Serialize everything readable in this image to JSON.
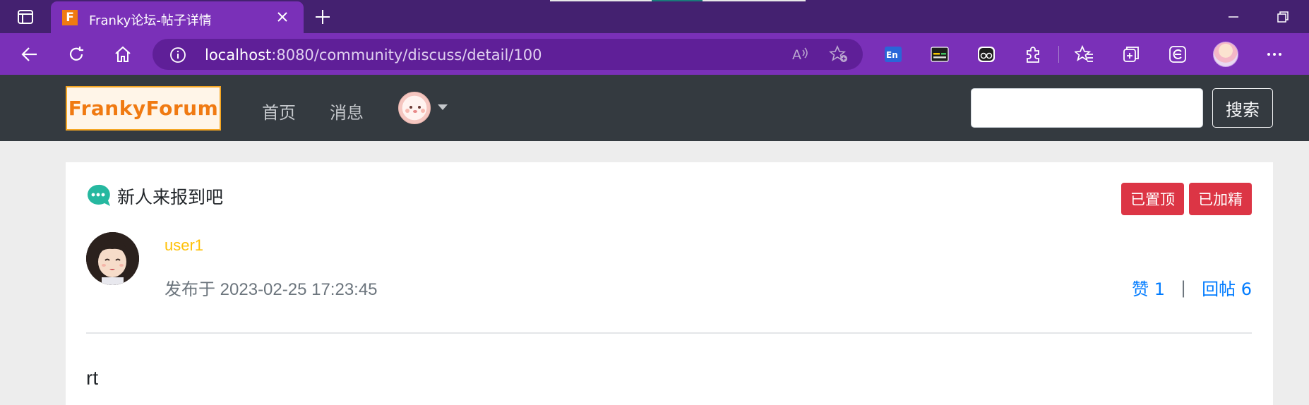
{
  "browser": {
    "tab_title": "Franky论坛-帖子详情",
    "tab_favicon_letter": "F",
    "url_host": "localhost",
    "url_rest": ":8080/community/discuss/detail/100",
    "chrome_color": "#7a30b8"
  },
  "site": {
    "logo_text": "FrankyForum",
    "nav": {
      "home": "首页",
      "messages": "消息"
    },
    "search": {
      "placeholder": "",
      "button": "搜索"
    }
  },
  "post": {
    "title": "新人来报到吧",
    "badges": {
      "top": "已置顶",
      "featured": "已加精"
    },
    "author": "user1",
    "publish_prefix": "发布于",
    "publish_time": "2023-02-25 17:23:45",
    "like_label": "赞 1",
    "reply_label": "回帖 6",
    "separator": "|",
    "body": "rt"
  },
  "colors": {
    "navbar": "#343a40",
    "badge": "#dc3545",
    "author": "#ffc107",
    "link": "#007bff"
  }
}
